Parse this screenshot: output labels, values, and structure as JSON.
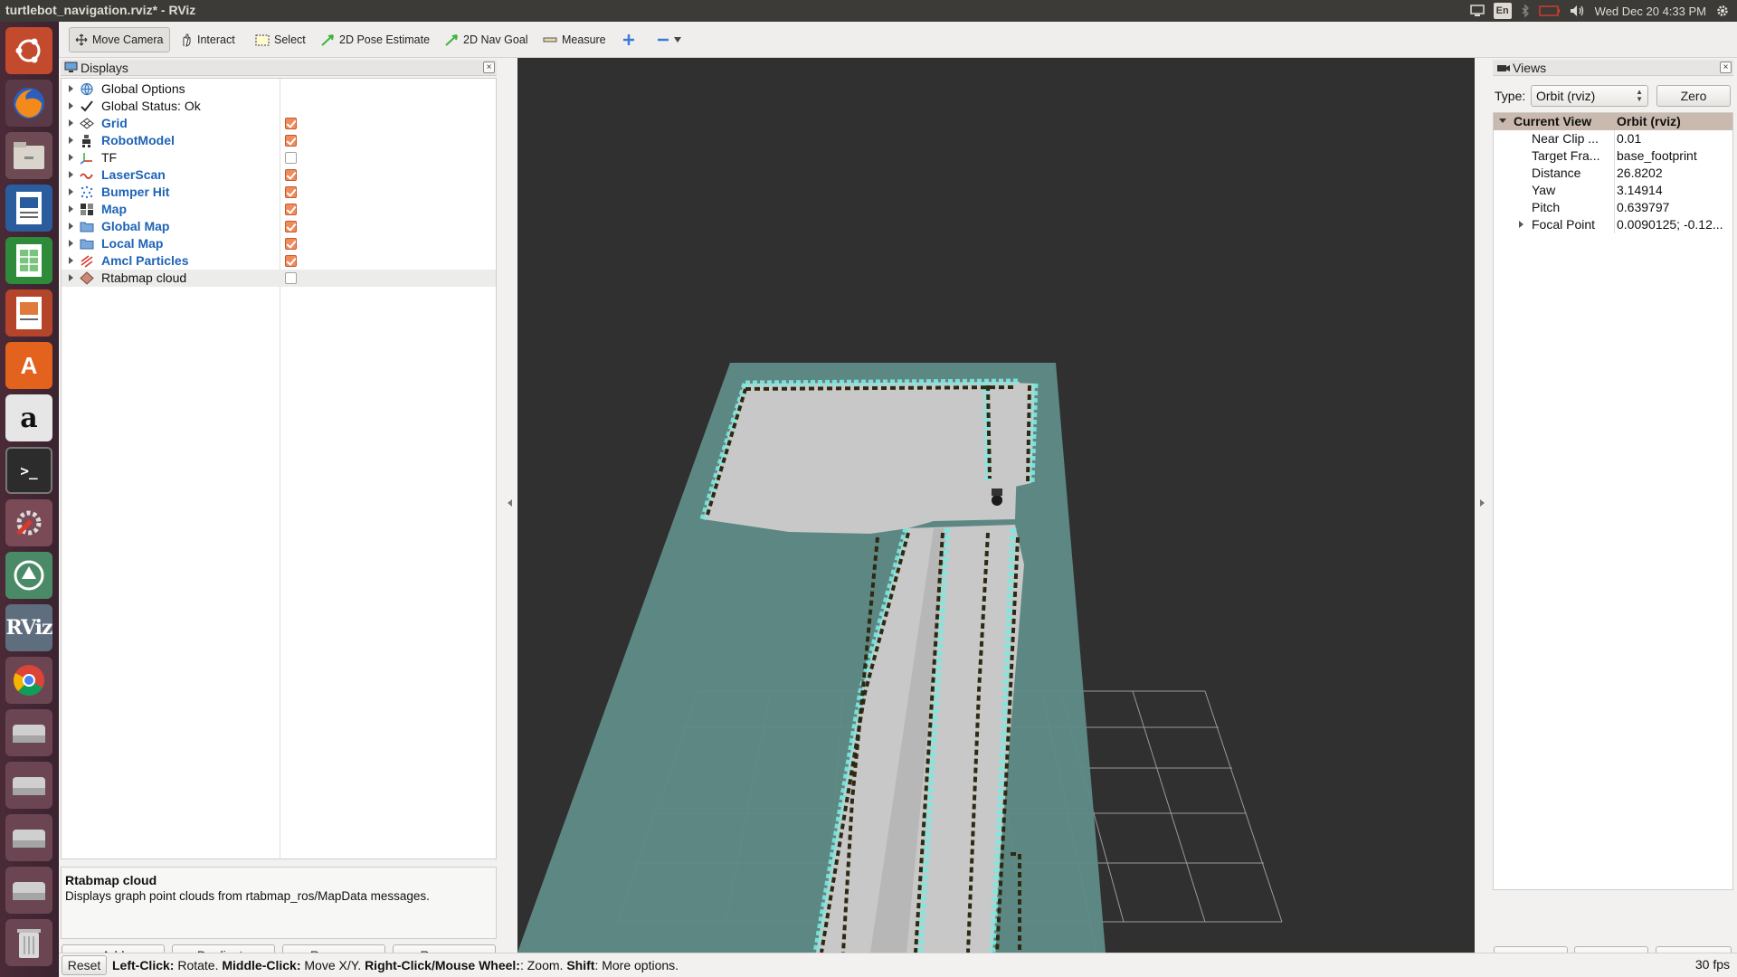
{
  "window": {
    "title": "turtlebot_navigation.rviz* - RViz"
  },
  "system_tray": {
    "language": "En",
    "datetime": "Wed Dec 20  4:33 PM"
  },
  "launcher": [
    {
      "name": "ubuntu-dash",
      "label": ""
    },
    {
      "name": "firefox",
      "label": ""
    },
    {
      "name": "files",
      "label": ""
    },
    {
      "name": "libreoffice-writer",
      "label": ""
    },
    {
      "name": "libreoffice-calc",
      "label": ""
    },
    {
      "name": "libreoffice-impress",
      "label": ""
    },
    {
      "name": "software-center",
      "label": "A"
    },
    {
      "name": "amazon",
      "label": "a"
    },
    {
      "name": "terminal",
      "label": ">_"
    },
    {
      "name": "system-settings",
      "label": ""
    },
    {
      "name": "software-updater",
      "label": ""
    },
    {
      "name": "rviz",
      "label": "RViz"
    },
    {
      "name": "chrome",
      "label": ""
    },
    {
      "name": "drive-1",
      "label": ""
    },
    {
      "name": "drive-2",
      "label": ""
    },
    {
      "name": "drive-3",
      "label": ""
    },
    {
      "name": "drive-4",
      "label": ""
    },
    {
      "name": "trash",
      "label": ""
    }
  ],
  "toolbar": {
    "move_camera": "Move Camera",
    "interact": "Interact",
    "select": "Select",
    "pose_estimate": "2D Pose Estimate",
    "nav_goal": "2D Nav Goal",
    "measure": "Measure"
  },
  "displays": {
    "title": "Displays",
    "items": [
      {
        "label": "Global Options",
        "checked": null,
        "style": "plain"
      },
      {
        "label": "Global Status: Ok",
        "checked": null,
        "style": "plain"
      },
      {
        "label": "Grid",
        "checked": true,
        "style": "blue"
      },
      {
        "label": "RobotModel",
        "checked": true,
        "style": "blue"
      },
      {
        "label": "TF",
        "checked": false,
        "style": "plain"
      },
      {
        "label": "LaserScan",
        "checked": true,
        "style": "blue"
      },
      {
        "label": "Bumper Hit",
        "checked": true,
        "style": "blue"
      },
      {
        "label": "Map",
        "checked": true,
        "style": "blue"
      },
      {
        "label": "Global Map",
        "checked": true,
        "style": "blue"
      },
      {
        "label": "Local Map",
        "checked": true,
        "style": "blue"
      },
      {
        "label": "Amcl Particles",
        "checked": true,
        "style": "blue"
      },
      {
        "label": "Rtabmap cloud",
        "checked": false,
        "style": "plain"
      }
    ],
    "description_title": "Rtabmap cloud",
    "description_text": "Displays graph point clouds from rtabmap_ros/MapData messages.",
    "buttons": {
      "add": "Add",
      "duplicate": "Duplicate",
      "remove": "Remove",
      "rename": "Rename"
    }
  },
  "views": {
    "title": "Views",
    "type_label": "Type:",
    "type_value": "Orbit (rviz)",
    "zero_button": "Zero",
    "header_key": "Current View",
    "header_value": "Orbit (rviz)",
    "properties": [
      {
        "key": "Near Clip ...",
        "value": "0.01"
      },
      {
        "key": "Target Fra...",
        "value": "base_footprint"
      },
      {
        "key": "Distance",
        "value": "26.8202"
      },
      {
        "key": "Yaw",
        "value": "3.14914"
      },
      {
        "key": "Pitch",
        "value": "0.639797"
      },
      {
        "key": "Focal Point",
        "value": "0.0090125; -0.12..."
      }
    ],
    "buttons": {
      "save": "Save",
      "remove": "Remove",
      "rename": "Rename"
    }
  },
  "statusbar": {
    "reset": "Reset",
    "left_click_key": "Left-Click:",
    "left_click_val": " Rotate. ",
    "middle_click_key": "Middle-Click:",
    "middle_click_val": " Move X/Y. ",
    "right_click_key": "Right-Click/Mouse Wheel:",
    "right_click_val": ": Zoom. ",
    "shift_key": "Shift",
    "shift_val": ": More options.",
    "fps": "30 fps"
  },
  "colors": {
    "map_plane": "#5f8a86",
    "free_space": "#c8c8c8",
    "walls": "#2e2a12",
    "inflation": "#7fe8e0",
    "viewport_bg": "#303030",
    "grid": "#9a9a9a",
    "checkbox_on": "#f08b5c"
  }
}
